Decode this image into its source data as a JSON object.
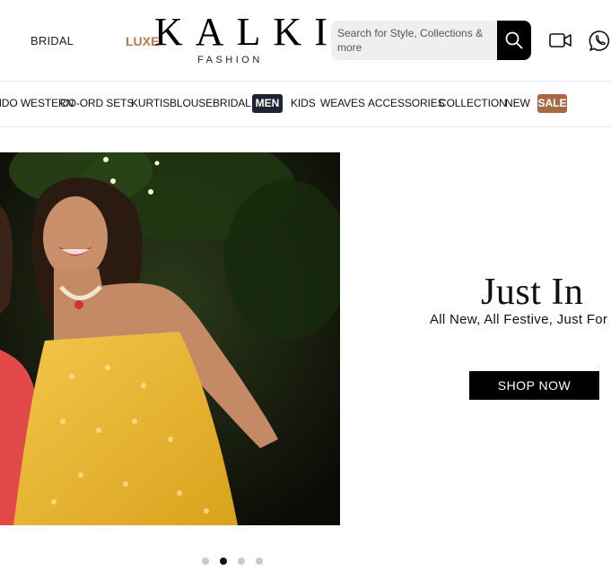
{
  "header": {
    "bridal_label": "BRIDAL",
    "luxe_label": "LUXE",
    "logo_main": "KALKI",
    "logo_sub": "FASHION",
    "search_placeholder": "Search for Style, Collections & more",
    "icons": [
      "search-icon",
      "video-call-icon",
      "whatsapp-icon"
    ]
  },
  "nav": {
    "items": [
      {
        "label": "INDO WESTERN"
      },
      {
        "label": "CO-ORD SETS"
      },
      {
        "label": "KURTIS"
      },
      {
        "label": "BLOUSE"
      },
      {
        "label": "BRIDAL"
      },
      {
        "label": "MEN",
        "highlight": "dark"
      },
      {
        "label": "KIDS"
      },
      {
        "label": "WEAVES"
      },
      {
        "label": "ACCESSORIES"
      },
      {
        "label": "COLLECTION"
      },
      {
        "label": "NEW"
      },
      {
        "label": "SALE",
        "highlight": "brown"
      }
    ]
  },
  "hero": {
    "title": "Just In",
    "subtitle": "All New, All Festive, Just For You",
    "cta": "SHOP NOW",
    "slides_total": 4,
    "active_slide": 2
  },
  "colors": {
    "accent_luxe": "#b87a4f",
    "men_pill": "#1f2433",
    "sale_pill": "#a86a45",
    "dark": "#000000"
  }
}
